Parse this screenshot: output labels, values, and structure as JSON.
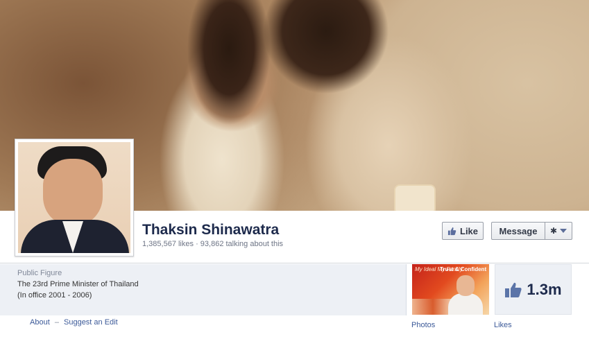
{
  "page": {
    "name": "Thaksin Shinawatra",
    "likes_count": "1,385,567 likes",
    "stats_separator": "·",
    "talking_about": "93,862 talking about this"
  },
  "actions": {
    "like_label": "Like",
    "message_label": "Message"
  },
  "about": {
    "category": "Public Figure",
    "description_lines": [
      "The 23rd Prime Minister of Thailand",
      "(In office 2001 - 2006)"
    ],
    "about_link": "About",
    "separator": "–",
    "suggest_edit_link": "Suggest an Edit"
  },
  "tiles": {
    "photos": {
      "label": "Photos",
      "thumb_text_1": "My Ideal My Family",
      "thumb_text_2": "Trust & Confident"
    },
    "likes": {
      "label": "Likes",
      "value": "1.3m"
    }
  },
  "colors": {
    "name": "#1d2a4c",
    "link": "#3b5998",
    "panel": "#edf0f5"
  },
  "icons": [
    "thumbs-up-icon",
    "gear-icon",
    "chevron-down-icon"
  ]
}
